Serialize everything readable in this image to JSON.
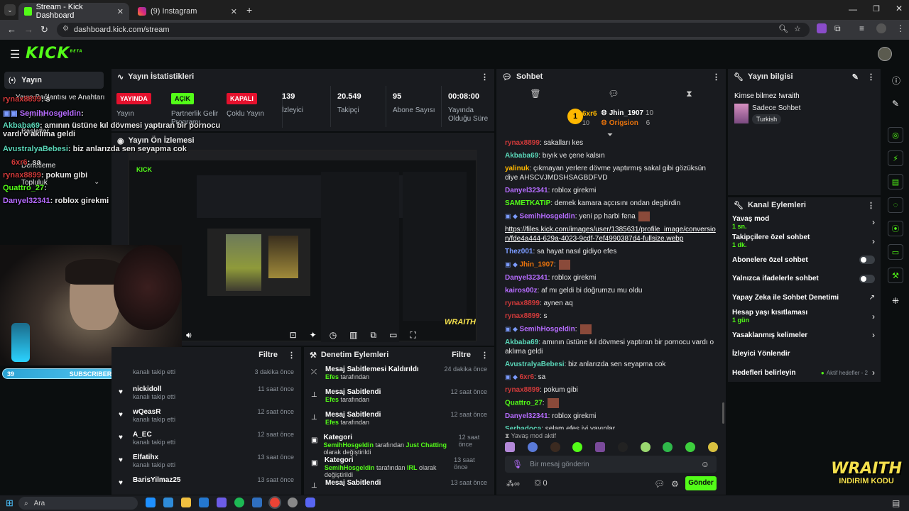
{
  "browser": {
    "tabs": [
      {
        "title": "Stream - Kick Dashboard"
      },
      {
        "title": "(9) Instagram"
      }
    ],
    "url": "dashboard.kick.com/stream"
  },
  "header": {
    "logo": "KICK",
    "logo_sup": "BETA"
  },
  "stats": {
    "title": "Yayın İstatistikleri",
    "items": [
      {
        "badge": "YAYINDA",
        "label": "Yayın"
      },
      {
        "badge": "AÇIK",
        "label": "Partnerlik Gelir Programı"
      },
      {
        "badge": "KAPALI",
        "label": "Çoklu Yayın"
      },
      {
        "value": "139",
        "label": "İzleyici"
      },
      {
        "value": "20.549",
        "label": "Takipçi"
      },
      {
        "value": "95",
        "label": "Abone Sayısı"
      },
      {
        "value": "00:08:00",
        "label": "Yayında Olduğu Süre"
      }
    ]
  },
  "sidebar": {
    "title": "Yayın",
    "items": [
      "Yayın Bağlantısı ve Anahtarı",
      "Ayarlar",
      "Başlatlar",
      "Denetleme",
      "Topluluk"
    ]
  },
  "preview": {
    "title": "Yayın Ön İzlemesi",
    "promo": "WRAITH",
    "promo2": "INDIRIM KODU"
  },
  "overlay_chat": [
    {
      "user": "rynax8899",
      "text": ": s"
    },
    {
      "user": "SemihHosgeldin",
      "text": ":"
    },
    {
      "user": "Akbaba69",
      "text": ": amının üstüne kıl dövmesi yaptıran bir pornocu vardı o aklıma geldi"
    },
    {
      "user": "AvustralyaBebesi",
      "text": ": biz anlarızda sen seyapma cok"
    },
    {
      "user": "6xr6",
      "text": ": sa"
    },
    {
      "user": "rynax8899",
      "text": ": pokum gibi"
    },
    {
      "user": "Quattro_27",
      "text": ":"
    },
    {
      "user": "Danyel32341",
      "text": ": roblox girekmi"
    }
  ],
  "subscribers": {
    "left": "39",
    "label": "SUBSCRIBERS",
    "right": "7"
  },
  "followers": {
    "filter": "Filtre",
    "rows": [
      {
        "name": "",
        "sub": "kanalı takip etti",
        "time": "3 dakika önce"
      },
      {
        "name": "nickidoll",
        "sub": "kanalı takip etti",
        "time": "11 saat önce"
      },
      {
        "name": "wQeasR",
        "sub": "kanalı takip etti",
        "time": "12 saat önce"
      },
      {
        "name": "A_EC",
        "sub": "kanalı takip etti",
        "time": "12 saat önce"
      },
      {
        "name": "Elfatihx",
        "sub": "kanalı takip etti",
        "time": "13 saat önce"
      },
      {
        "name": "BarisYilmaz25",
        "sub": "",
        "time": "13 saat önce"
      }
    ]
  },
  "modlog": {
    "title": "Denetim Eylemleri",
    "filter": "Filtre",
    "rows": [
      {
        "title": "Mesaj Sabitlemesi Kaldırıldı",
        "by": "Efes",
        "rest": " tarafından",
        "time": "24 dakika önce"
      },
      {
        "title": "Mesaj Sabitlendi",
        "by": "Efes",
        "rest": " tarafından",
        "time": "12 saat önce"
      },
      {
        "title": "Mesaj Sabitlendi",
        "by": "Efes",
        "rest": " tarafından",
        "time": "12 saat önce"
      },
      {
        "title": "Kategori",
        "by": "SemihHosgeldin",
        "rest": " tarafından ",
        "cat": "Just Chatting",
        "rest2": " olarak değiştirildi",
        "time": "12 saat önce"
      },
      {
        "title": "Kategori",
        "by": "SemihHosgeldin",
        "rest": " tarafından ",
        "cat": "IRL",
        "rest2": " olarak değiştirildi",
        "time": "13 saat önce"
      },
      {
        "title": "Mesaj Sabitlendi",
        "by": "",
        "rest": "",
        "time": "13 saat önce"
      }
    ]
  },
  "chat": {
    "title": "Sohbet",
    "top": [
      {
        "rank": "1",
        "name": "6xr6",
        "count": "10"
      },
      {
        "name": "Jhin_1907",
        "count": "10"
      },
      {
        "name": "Origsion",
        "count": "6"
      }
    ],
    "messages": [
      {
        "user": "rynax8899",
        "cls": "u-red",
        "text": ": sakalları kes"
      },
      {
        "user": "Akbaba69",
        "cls": "u-tea",
        "text": ": bıyık ve çene kalsın"
      },
      {
        "user": "yalinuk",
        "cls": "u-yel",
        "text": ": çıkmayan yerlere dövme yaptırmış sakal gibi gözüksün diye AHSCVJMDSHSAGBDFVD"
      },
      {
        "user": "Danyel32341",
        "cls": "u-pur",
        "text": ": roblox girekmi"
      },
      {
        "user": "SAMETKATIP",
        "cls": "u-gre",
        "text": ": demek kamara açcısını ondan degitirdin"
      },
      {
        "user": "SemihHosgeldin",
        "cls": "u-pur",
        "text": ": yeni pp harbi fena"
      },
      {
        "user": "",
        "cls": "",
        "text": "https://files.kick.com/images/user/1385631/profile_image/conversion/fde4a444-629a-4023-9cdf-7ef4990387d4-fullsize.webp"
      },
      {
        "user": "Thez001",
        "cls": "u-blu",
        "text": ": sa hayat nasıl gidiyo efes"
      },
      {
        "user": "Jhin_1907",
        "cls": "u-ora",
        "text": ":"
      },
      {
        "user": "Danyel32341",
        "cls": "u-pur",
        "text": ": roblox girekmi"
      },
      {
        "user": "kairos00z",
        "cls": "u-pur",
        "text": ": af mı geldi bi doğrumzu mu oldu"
      },
      {
        "user": "rynax8899",
        "cls": "u-red",
        "text": ": aynen aq"
      },
      {
        "user": "rynax8899",
        "cls": "u-red",
        "text": ": s"
      },
      {
        "user": "SemihHosgeldin",
        "cls": "u-pur",
        "text": ":"
      },
      {
        "user": "Akbaba69",
        "cls": "u-tea",
        "text": ": amının üstüne kıl dövmesi yaptıran bir pornocu vardı o aklıma geldi"
      },
      {
        "user": "AvustralyaBebesi",
        "cls": "u-tea",
        "text": ": biz anlarızda sen seyapma cok"
      },
      {
        "user": "6xr6",
        "cls": "u-red",
        "text": ": sa"
      },
      {
        "user": "rynax8899",
        "cls": "u-red",
        "text": ": pokum gibi"
      },
      {
        "user": "Quattro_27",
        "cls": "u-gre",
        "text": ":"
      },
      {
        "user": "Danyel32341",
        "cls": "u-pur",
        "text": ": roblox girekmi"
      },
      {
        "user": "Serhadoca",
        "cls": "u-tea",
        "text": ": selam efes iyi yayınlar"
      }
    ],
    "slowmode": "Yavaş mod aktif",
    "placeholder": "Bir mesaj gönderin",
    "points": "0",
    "send": "Gönder"
  },
  "streaminfo": {
    "title": "Yayın bilgisi",
    "stream_title": "Kimse bilmez !wraith",
    "category": "Sadece Sohbet",
    "language": "Turkish"
  },
  "channel_actions": {
    "title": "Kanal Eylemleri",
    "items": [
      {
        "label": "Yavaş mod",
        "sub": "1 sn.",
        "kind": "arrow"
      },
      {
        "label": "Takipçilere özel sohbet",
        "sub": "1 dk.",
        "kind": "arrow"
      },
      {
        "label": "Abonelere özel sohbet",
        "sub": "",
        "kind": "toggle"
      },
      {
        "label": "Yalnızca ifadelerle sohbet",
        "sub": "",
        "kind": "toggle"
      },
      {
        "label": "Yapay Zeka ile Sohbet Denetimi",
        "sub": "",
        "kind": "ext"
      },
      {
        "label": "Hesap yaşı kısıtlaması",
        "sub": "1 gün",
        "kind": "arrow"
      },
      {
        "label": "Yasaklanmış kelimeler",
        "sub": "",
        "kind": "arrow"
      },
      {
        "label": "İzleyici Yönlendir",
        "sub": "",
        "kind": "none"
      },
      {
        "label": "Hedefleri belirleyin",
        "sub": "",
        "kind": "goal",
        "extra": "Aktif hedefler - 2"
      }
    ]
  },
  "taskbar": {
    "search": "Ara"
  },
  "colors": {
    "accent": "#53fc18",
    "panel": "#191b1f",
    "bg": "#0b0e0f",
    "live": "#e5112d"
  }
}
